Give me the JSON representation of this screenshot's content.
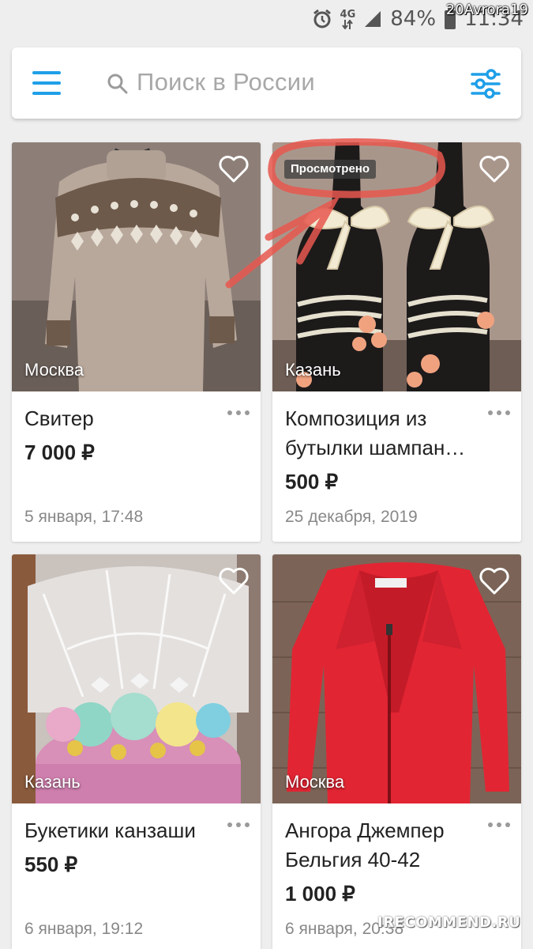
{
  "status_bar": {
    "network": "4G",
    "battery": "84%",
    "time": "11:34",
    "watermark_user": "20Avrora19"
  },
  "header": {
    "search_placeholder": "Поиск в России"
  },
  "listings": [
    {
      "title": "Свитер",
      "price": "7 000 ₽",
      "city": "Москва",
      "date": "5 января, 17:48",
      "badge": ""
    },
    {
      "title": "Композиция из бутылки шампан…",
      "price": "500 ₽",
      "city": "Казань",
      "date": "25 декабря, 2019",
      "badge": "Просмотрено"
    },
    {
      "title": "Букетики канзаши",
      "price": "550 ₽",
      "city": "Казань",
      "date": "6 января, 19:12",
      "badge": ""
    },
    {
      "title": "Ангора Джемпер Бельгия 40-42",
      "price": "1 000 ₽",
      "city": "Москва",
      "date": "6 января, 20:38",
      "badge": ""
    }
  ],
  "watermark_site": "IRECOMMEND.RU",
  "colors": {
    "accent": "#1f9fe8",
    "background": "#eeeeee",
    "annotation": "#e8584f"
  }
}
